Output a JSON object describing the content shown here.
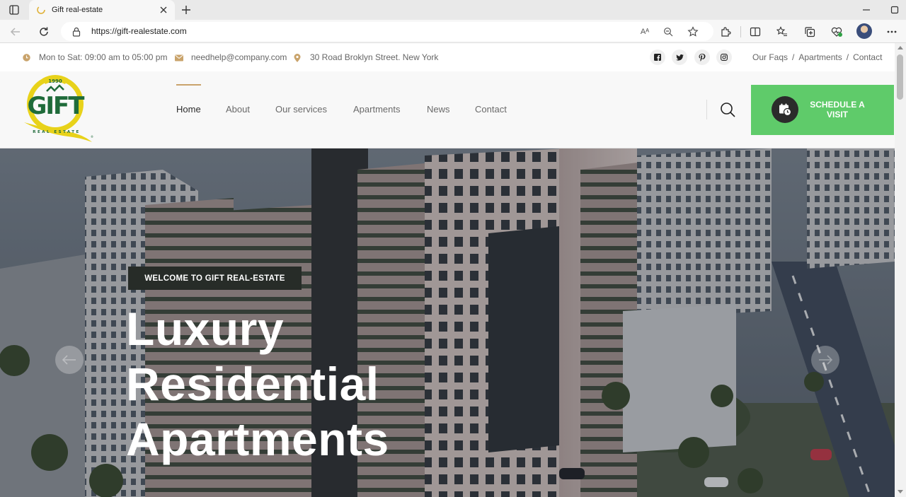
{
  "browser": {
    "tab_title": "Gift real-estate",
    "url": "https://gift-realestate.com",
    "read_aloud_label": "Aᴬ"
  },
  "topbar": {
    "hours": "Mon to Sat: 09:00 am to 05:00 pm",
    "email": "needhelp@company.com",
    "address": "30 Road Broklyn Street. New York",
    "social": [
      "facebook-icon",
      "twitter-icon",
      "pinterest-icon",
      "instagram-icon"
    ],
    "links": [
      "Our Faqs",
      "Apartments",
      "Contact"
    ],
    "link_separator": "/"
  },
  "logo": {
    "year": "1990",
    "wordmark": "GIFT",
    "tagline": "REAL ESTATE",
    "registered": "®"
  },
  "nav": {
    "items": [
      "Home",
      "About",
      "Our services",
      "Apartments",
      "News",
      "Contact"
    ],
    "active": "Home"
  },
  "cta": {
    "line1": "SCHEDULE A",
    "line2": "VISIT"
  },
  "hero": {
    "eyebrow": "WELCOME TO GIFT REAL-ESTATE",
    "title_lines": [
      "Luxury",
      "Residential",
      "Apartments"
    ]
  },
  "colors": {
    "accent_gold": "#c9a36b",
    "cta_green": "#5fcb6a",
    "eyebrow_bg": "#272c28",
    "logo_yellow": "#e8d21a",
    "logo_green": "#1f6b3a"
  }
}
